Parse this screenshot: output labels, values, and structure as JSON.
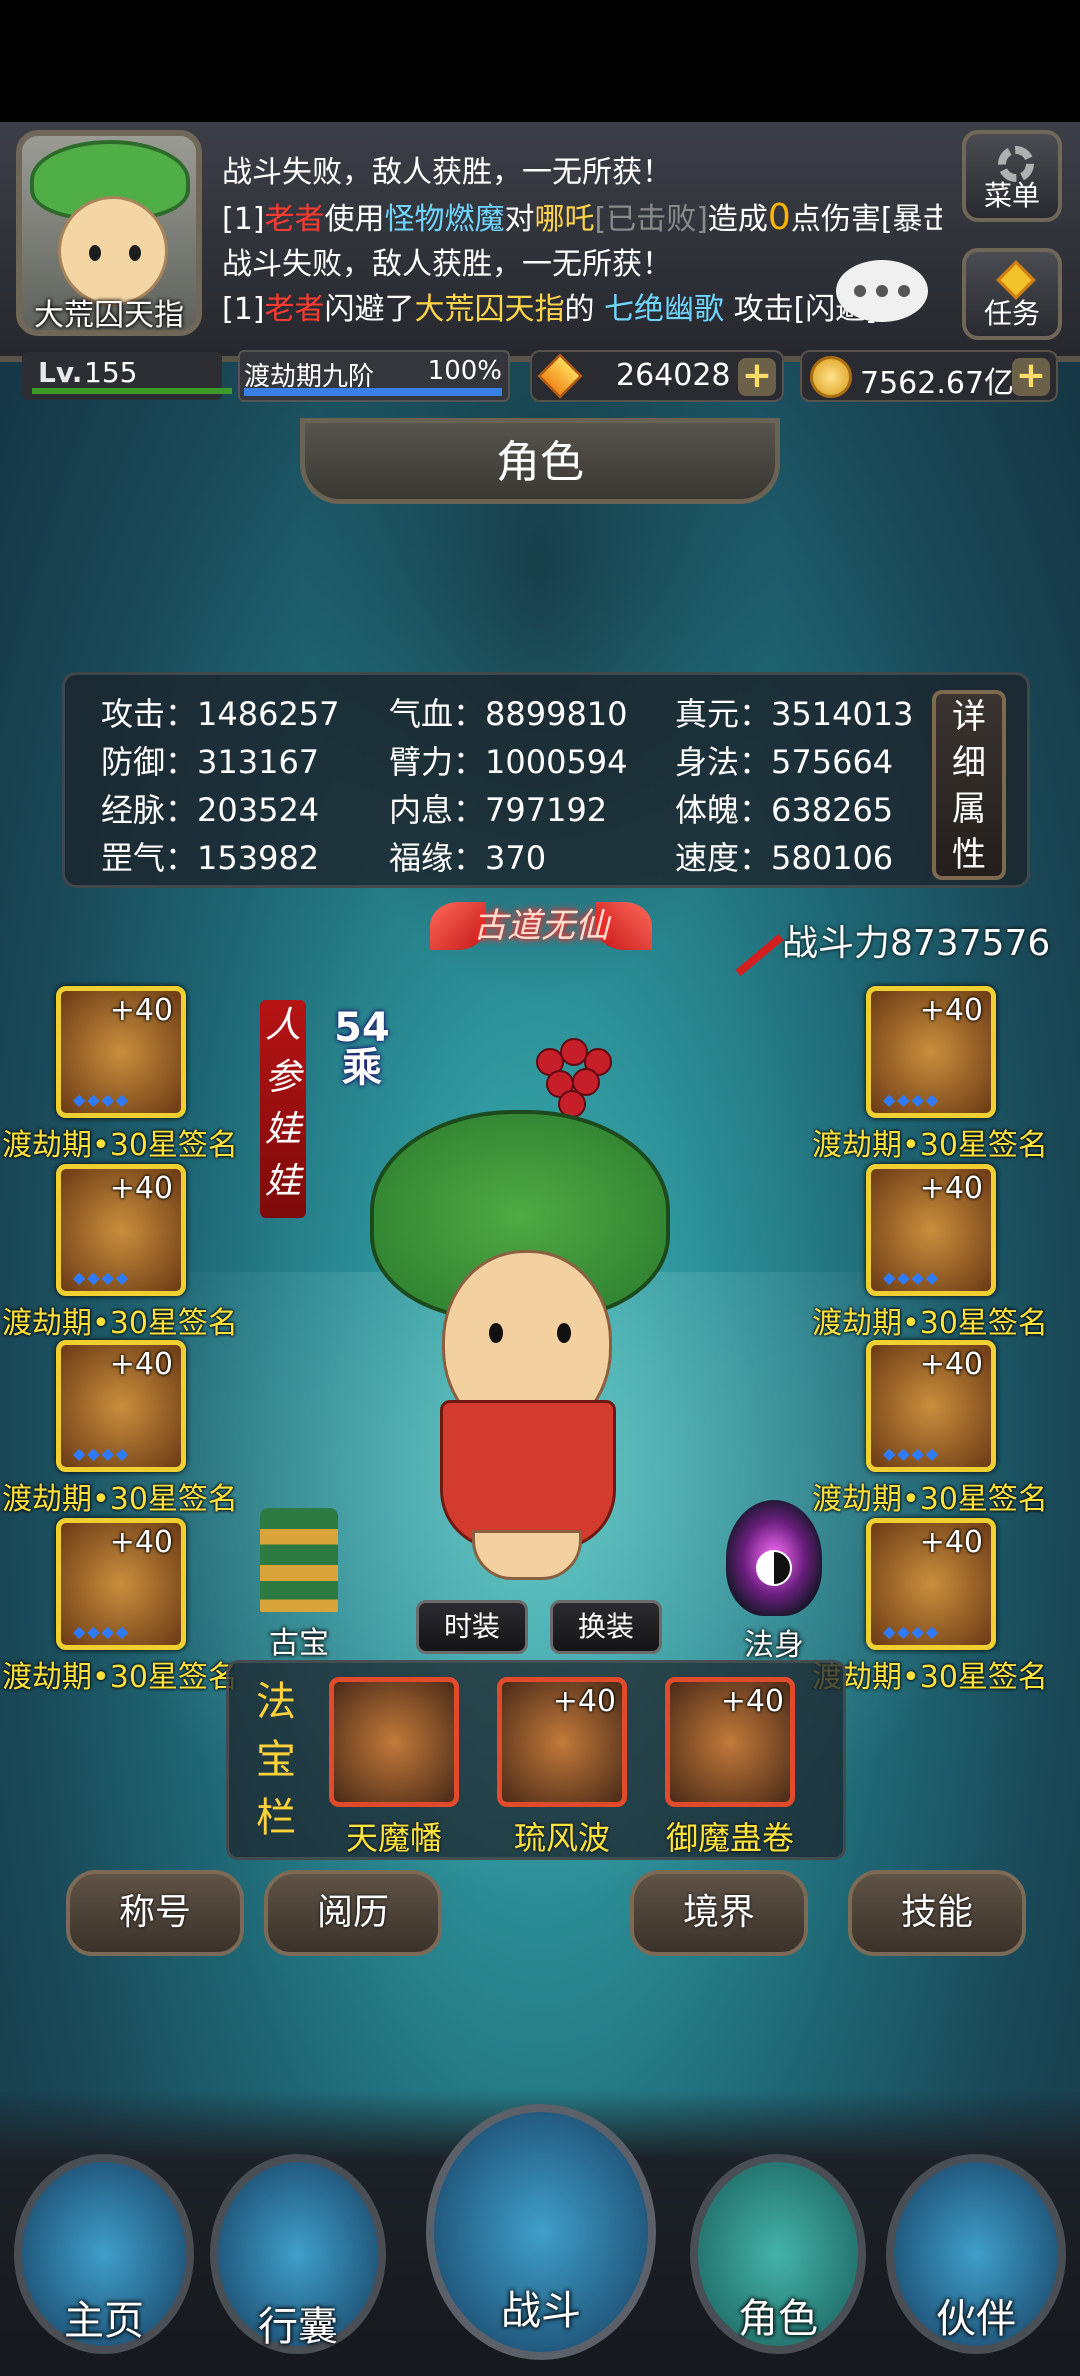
{
  "header": {
    "avatar_name": "大荒囚天指",
    "log": [
      [
        {
          "t": "战斗失败，敌人获胜，一无所获！",
          "c": ""
        }
      ],
      [
        {
          "t": "[1]",
          "c": ""
        },
        {
          "t": "老者",
          "c": "red"
        },
        {
          "t": "使用",
          "c": ""
        },
        {
          "t": "怪物燃魔",
          "c": "blue"
        },
        {
          "t": "对",
          "c": ""
        },
        {
          "t": "哪吒",
          "c": "yellow"
        },
        {
          "t": "[已击败]",
          "c": "gray"
        },
        {
          "t": "造成",
          "c": ""
        },
        {
          "t": "0",
          "c": "num"
        },
        {
          "t": "点伤害[暴击]",
          "c": ""
        }
      ],
      [
        {
          "t": "战斗失败，敌人获胜，一无所获！",
          "c": ""
        }
      ],
      [
        {
          "t": "[1]",
          "c": ""
        },
        {
          "t": "老者",
          "c": "red"
        },
        {
          "t": "闪避了",
          "c": ""
        },
        {
          "t": "大荒囚天指",
          "c": "yellow"
        },
        {
          "t": "的 ",
          "c": ""
        },
        {
          "t": "七绝幽歌",
          "c": "blue"
        },
        {
          "t": " 攻击[闪避]",
          "c": ""
        }
      ]
    ],
    "menu_label": "菜单",
    "task_label": "任务"
  },
  "resources": {
    "level_label": "Lv.",
    "level": "155",
    "realm": "渡劫期九阶",
    "realm_progress": "100%",
    "gems": "264028",
    "gold": "7562.67亿",
    "plus": "+"
  },
  "page_title": "角色",
  "stats": [
    {
      "label": "攻击：1486257"
    },
    {
      "label": "气血：8899810"
    },
    {
      "label": "真元：3514013"
    },
    {
      "label": "防御：313167"
    },
    {
      "label": "臂力：1000594"
    },
    {
      "label": "身法：575664"
    },
    {
      "label": "经脉：203524"
    },
    {
      "label": "内息：797192"
    },
    {
      "label": "体魄：638265"
    },
    {
      "label": "罡气：153982"
    },
    {
      "label": "福缘：370"
    },
    {
      "label": "速度：580106"
    }
  ],
  "detail_button": [
    "详",
    "细",
    "属",
    "性"
  ],
  "title_badge": "古道无仙",
  "combat_power": "战斗力8737576",
  "character": {
    "name_vertical": [
      "人",
      "参",
      "娃",
      "娃"
    ],
    "rank_number": "54",
    "rank_unit": "乘"
  },
  "equipment": {
    "left": [
      {
        "enhance": "+40",
        "caption": "渡劫期•30星签名"
      },
      {
        "enhance": "+40",
        "caption": "渡劫期•30星签名"
      },
      {
        "enhance": "+40",
        "caption": "渡劫期•30星签名"
      },
      {
        "enhance": "+40",
        "caption": "渡劫期•30星签名"
      }
    ],
    "right": [
      {
        "enhance": "+40",
        "caption": "渡劫期•30星签名"
      },
      {
        "enhance": "+40",
        "caption": "渡劫期•30星签名"
      },
      {
        "enhance": "+40",
        "caption": "渡劫期•30星签名"
      },
      {
        "enhance": "+40",
        "caption": "渡劫期•30星签名"
      }
    ],
    "star_dots": "◆◆◆◆"
  },
  "outfit_buttons": {
    "fashion": "时装",
    "change": "换装"
  },
  "gubao_label": "古宝",
  "fashen_label": "法身",
  "treasure_bar": {
    "label": [
      "法",
      "宝",
      "栏"
    ],
    "items": [
      {
        "name": "天魔幡",
        "enhance": ""
      },
      {
        "name": "琉风波",
        "enhance": "+40"
      },
      {
        "name": "御魔蛊卷",
        "enhance": "+40"
      }
    ]
  },
  "action_buttons": [
    "称号",
    "阅历",
    "境界",
    "技能"
  ],
  "nav": [
    "主页",
    "行囊",
    "战斗",
    "角色",
    "伙伴"
  ],
  "colors": {
    "accent_gold": "#ffe23c",
    "slot_border": "#f0d030",
    "treasure_border": "#e14a2a"
  }
}
